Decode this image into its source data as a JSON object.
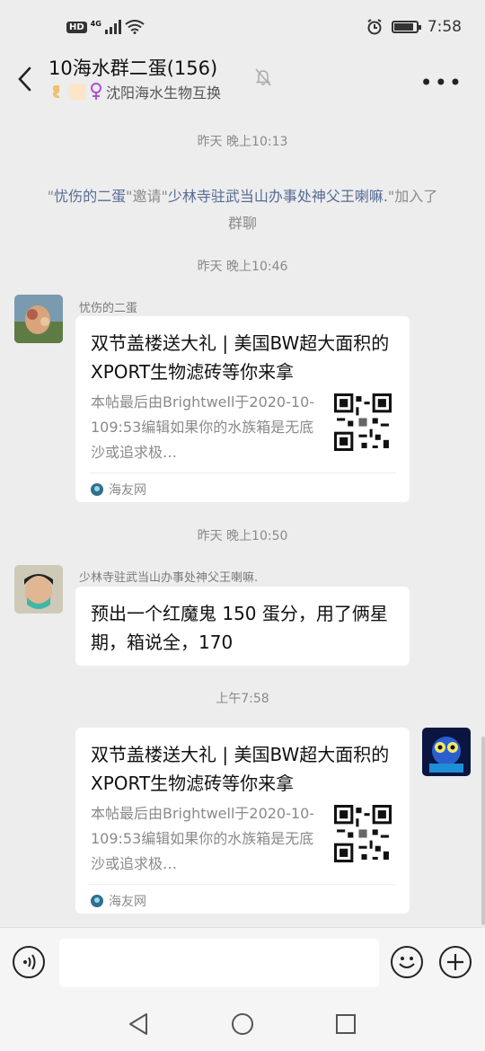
{
  "status_bar": {
    "network_badge": "HD",
    "network_type": "4G",
    "time": "7:58",
    "battery_level": 0.9
  },
  "header": {
    "title": "10海水群二蛋(156)",
    "subtitle": "沈阳海水生物互换",
    "icons": [
      "back-arrow-icon",
      "mute-bell-icon",
      "more-icon"
    ]
  },
  "messages": {
    "time1": "昨天 晚上10:13",
    "system": {
      "q1": "\"",
      "inviter": "忧伤的二蛋",
      "mid": "\"邀请\"",
      "invitee": "少林寺驻武当山办事处神父王喇嘛.",
      "tail": "\"加入了群聊"
    },
    "time2": "昨天 晚上10:46",
    "msg1": {
      "sender": "忧伤的二蛋",
      "title": "双节盖楼送大礼 | 美国BW超大面积的XPORT生物滤砖等你来拿",
      "desc": "本帖最后由Brightwell于2020-10-109:53编辑如果你的水族箱是无底沙或追求极…",
      "source": "海友网"
    },
    "time3": "昨天 晚上10:50",
    "msg2": {
      "sender": "少林寺驻武当山办事处神父王喇嘛.",
      "text": "预出一个红魔鬼 150 蛋分，用了俩星期，箱说全，170"
    },
    "time4": "上午7:58",
    "msg3": {
      "title": "双节盖楼送大礼 | 美国BW超大面积的XPORT生物滤砖等你来拿",
      "desc": "本帖最后由Brightwell于2020-10-109:53编辑如果你的水族箱是无底沙或追求极…",
      "source": "海友网"
    }
  },
  "input_bar": {
    "icons": [
      "voice-icon",
      "emoji-icon",
      "plus-icon"
    ]
  },
  "nav_bar": {
    "icons": [
      "nav-back-icon",
      "nav-home-icon",
      "nav-recents-icon"
    ]
  }
}
